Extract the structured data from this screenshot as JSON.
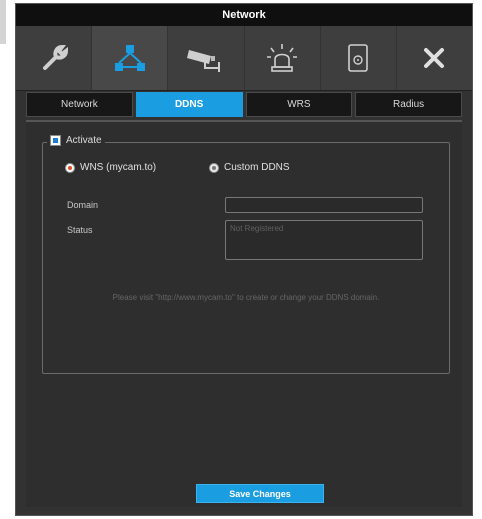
{
  "window": {
    "title": "Network"
  },
  "toolbar": {
    "icons": [
      "wrench-icon",
      "network-icon",
      "camera-icon",
      "alarm-icon",
      "storage-icon",
      "close-icon"
    ],
    "active_index": 1
  },
  "tabs": [
    {
      "label": "Network",
      "active": false
    },
    {
      "label": "DDNS",
      "active": true
    },
    {
      "label": "WRS",
      "active": false
    },
    {
      "label": "Radius",
      "active": false
    }
  ],
  "ddns": {
    "activate_label": "Activate",
    "activate_checked": true,
    "options": [
      {
        "label": "WNS (mycam.to)",
        "selected": true
      },
      {
        "label": "Custom DDNS",
        "selected": false
      }
    ],
    "domain_label": "Domain",
    "domain_value": "",
    "status_label": "Status",
    "status_value": "Not Registered",
    "hint": "Please visit \"http://www.mycam.to\" to create or change your DDNS domain."
  },
  "actions": {
    "save_label": "Save Changes"
  },
  "colors": {
    "accent": "#1b9de2",
    "radio_selected": "#e34a2a",
    "background": "#323232"
  }
}
